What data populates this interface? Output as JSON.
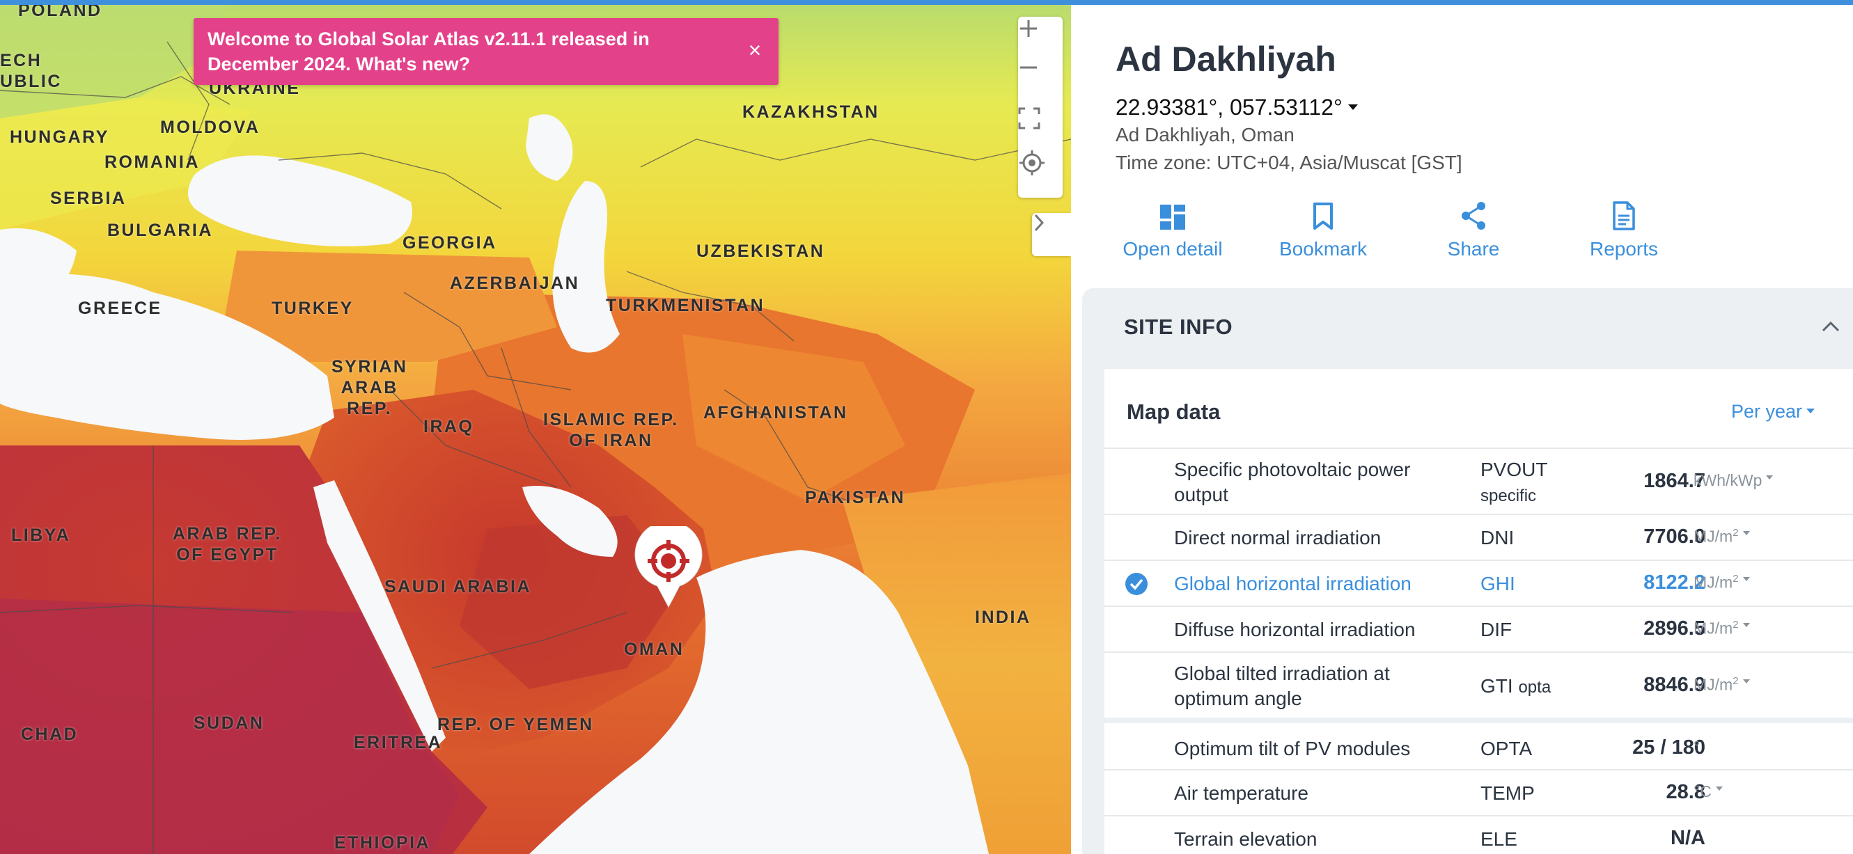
{
  "banner": {
    "text": "Welcome to Global Solar Atlas v2.11.1 released in December 2024. What's new?",
    "close": "×"
  },
  "map": {
    "countries": [
      {
        "key": "poland",
        "label": "POLAND"
      },
      {
        "key": "czech",
        "label": "ECH\nUBLIC"
      },
      {
        "key": "ukraine",
        "label": "UKRAINE"
      },
      {
        "key": "hungary",
        "label": "HUNGARY"
      },
      {
        "key": "moldova",
        "label": "MOLDOVA"
      },
      {
        "key": "romania",
        "label": "ROMANIA"
      },
      {
        "key": "serbia",
        "label": "SERBIA"
      },
      {
        "key": "bulgaria",
        "label": "BULGARIA"
      },
      {
        "key": "kazakhstan",
        "label": "KAZAKHSTAN"
      },
      {
        "key": "georgia",
        "label": "GEORGIA"
      },
      {
        "key": "uzbekistan",
        "label": "UZBEKISTAN"
      },
      {
        "key": "azerbaijan",
        "label": "AZERBAIJAN"
      },
      {
        "key": "greece",
        "label": "GREECE"
      },
      {
        "key": "turkey",
        "label": "TURKEY"
      },
      {
        "key": "turkmenistan",
        "label": "TURKMENISTAN"
      },
      {
        "key": "syria",
        "label": "SYRIAN\nARAB\nREP."
      },
      {
        "key": "iraq",
        "label": "IRAQ"
      },
      {
        "key": "iran",
        "label": "ISLAMIC REP.\nOF IRAN"
      },
      {
        "key": "afghanistan",
        "label": "AFGHANISTAN"
      },
      {
        "key": "pakistan",
        "label": "PAKISTAN"
      },
      {
        "key": "libya",
        "label": "LIBYA"
      },
      {
        "key": "egypt",
        "label": "ARAB REP.\nOF EGYPT"
      },
      {
        "key": "saudi",
        "label": "SAUDI ARABIA"
      },
      {
        "key": "india",
        "label": "INDIA"
      },
      {
        "key": "oman",
        "label": "OMAN"
      },
      {
        "key": "chad",
        "label": "CHAD"
      },
      {
        "key": "sudan",
        "label": "SUDAN"
      },
      {
        "key": "eritrea",
        "label": "ERITREA"
      },
      {
        "key": "yemen",
        "label": "REP. OF YEMEN"
      },
      {
        "key": "ethiopia",
        "label": "ETHIOPIA"
      }
    ],
    "controls": {
      "zoom_in": "+",
      "zoom_out": "−"
    }
  },
  "site": {
    "title": "Ad Dakhliyah",
    "coords": "22.93381°, 057.53112°",
    "place": "Ad Dakhliyah, Oman",
    "timezone": "Time zone: UTC+04, Asia/Muscat [GST]"
  },
  "actions": [
    {
      "label": "Open detail"
    },
    {
      "label": "Bookmark"
    },
    {
      "label": "Share"
    },
    {
      "label": "Reports"
    }
  ],
  "siteinfo": {
    "section_title": "SITE INFO",
    "card_title": "Map data",
    "period": "Per year",
    "rows": [
      {
        "name": "Specific photovoltaic power output",
        "abbr": "PVOUT",
        "abbr_sub": "specific",
        "value": "1864.7",
        "unit": "kWh/kWp",
        "unit_sup": ""
      },
      {
        "name": "Direct normal irradiation",
        "abbr": "DNI",
        "abbr_sub": "",
        "value": "7706.0",
        "unit": "MJ/m",
        "unit_sup": "2"
      },
      {
        "name": "Global horizontal irradiation",
        "abbr": "GHI",
        "abbr_sub": "",
        "value": "8122.2",
        "unit": "MJ/m",
        "unit_sup": "2"
      },
      {
        "name": "Diffuse horizontal irradiation",
        "abbr": "DIF",
        "abbr_sub": "",
        "value": "2896.5",
        "unit": "MJ/m",
        "unit_sup": "2"
      },
      {
        "name": "Global tilted irradiation at optimum angle",
        "abbr": "GTI",
        "abbr_sub": "opta",
        "value": "8846.9",
        "unit": "MJ/m",
        "unit_sup": "2"
      },
      {
        "name": "Optimum tilt of PV modules",
        "abbr": "OPTA",
        "abbr_sub": "",
        "value": "25 /  180",
        "unit": "°",
        "unit_sup": ""
      },
      {
        "name": "Air temperature",
        "abbr": "TEMP",
        "abbr_sub": "",
        "value": "28.8",
        "unit": "°C",
        "unit_sup": ""
      },
      {
        "name": "Terrain elevation",
        "abbr": "ELE",
        "abbr_sub": "",
        "value": "N/A",
        "unit": "",
        "unit_sup": ""
      }
    ]
  },
  "colors": {
    "accent": "#3a8fdc",
    "banner": "#e3418a",
    "pin": "#c22a2a"
  }
}
